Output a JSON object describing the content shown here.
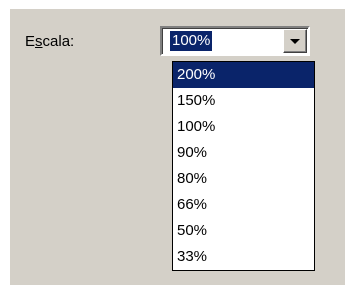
{
  "scale": {
    "label_prefix": "E",
    "label_accel": "s",
    "label_suffix": "cala:",
    "current_value": "100%",
    "options": [
      "200%",
      "150%",
      "100%",
      "90%",
      "80%",
      "66%",
      "50%",
      "33%"
    ],
    "highlighted_option": "200%",
    "icon": "chevron-down-icon"
  },
  "colors": {
    "dialog_background": "#d4d0c8",
    "selection_background": "#0a246a",
    "selection_text": "#ffffff"
  }
}
